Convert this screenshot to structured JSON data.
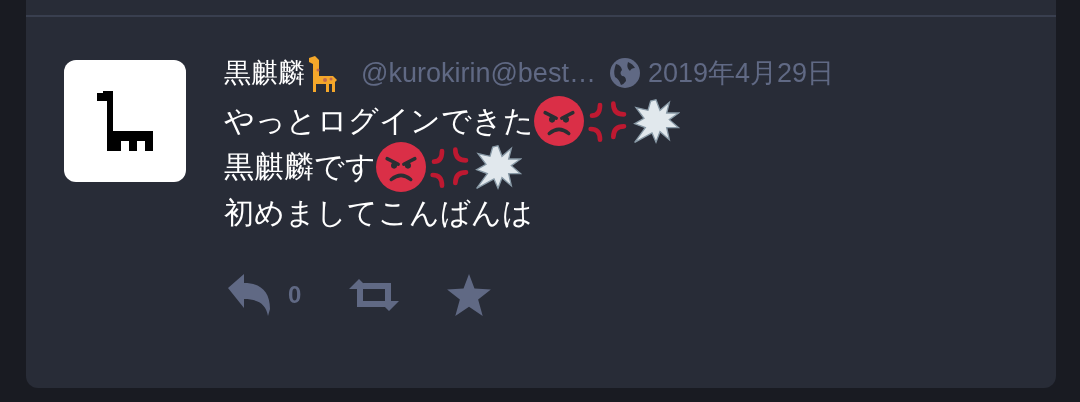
{
  "status": {
    "display_name": "黒麒麟",
    "name_badge": {
      "kind": "giraffe"
    },
    "handle": "@kurokirin@best…",
    "public": true,
    "date": "2019年4月29日",
    "lines": [
      {
        "text": "やっとログインできた",
        "emojis": [
          {
            "kind": "angry"
          },
          {
            "kind": "anger"
          },
          {
            "kind": "burst"
          }
        ]
      },
      {
        "text": "黒麒麟です",
        "emojis": [
          {
            "kind": "angry"
          },
          {
            "kind": "anger"
          },
          {
            "kind": "burst"
          }
        ]
      },
      {
        "text": "初めましてこんばんは"
      }
    ],
    "actions": [
      {
        "kind": "reply",
        "count": "0"
      },
      {
        "kind": "boost"
      },
      {
        "kind": "favourite"
      }
    ]
  }
}
